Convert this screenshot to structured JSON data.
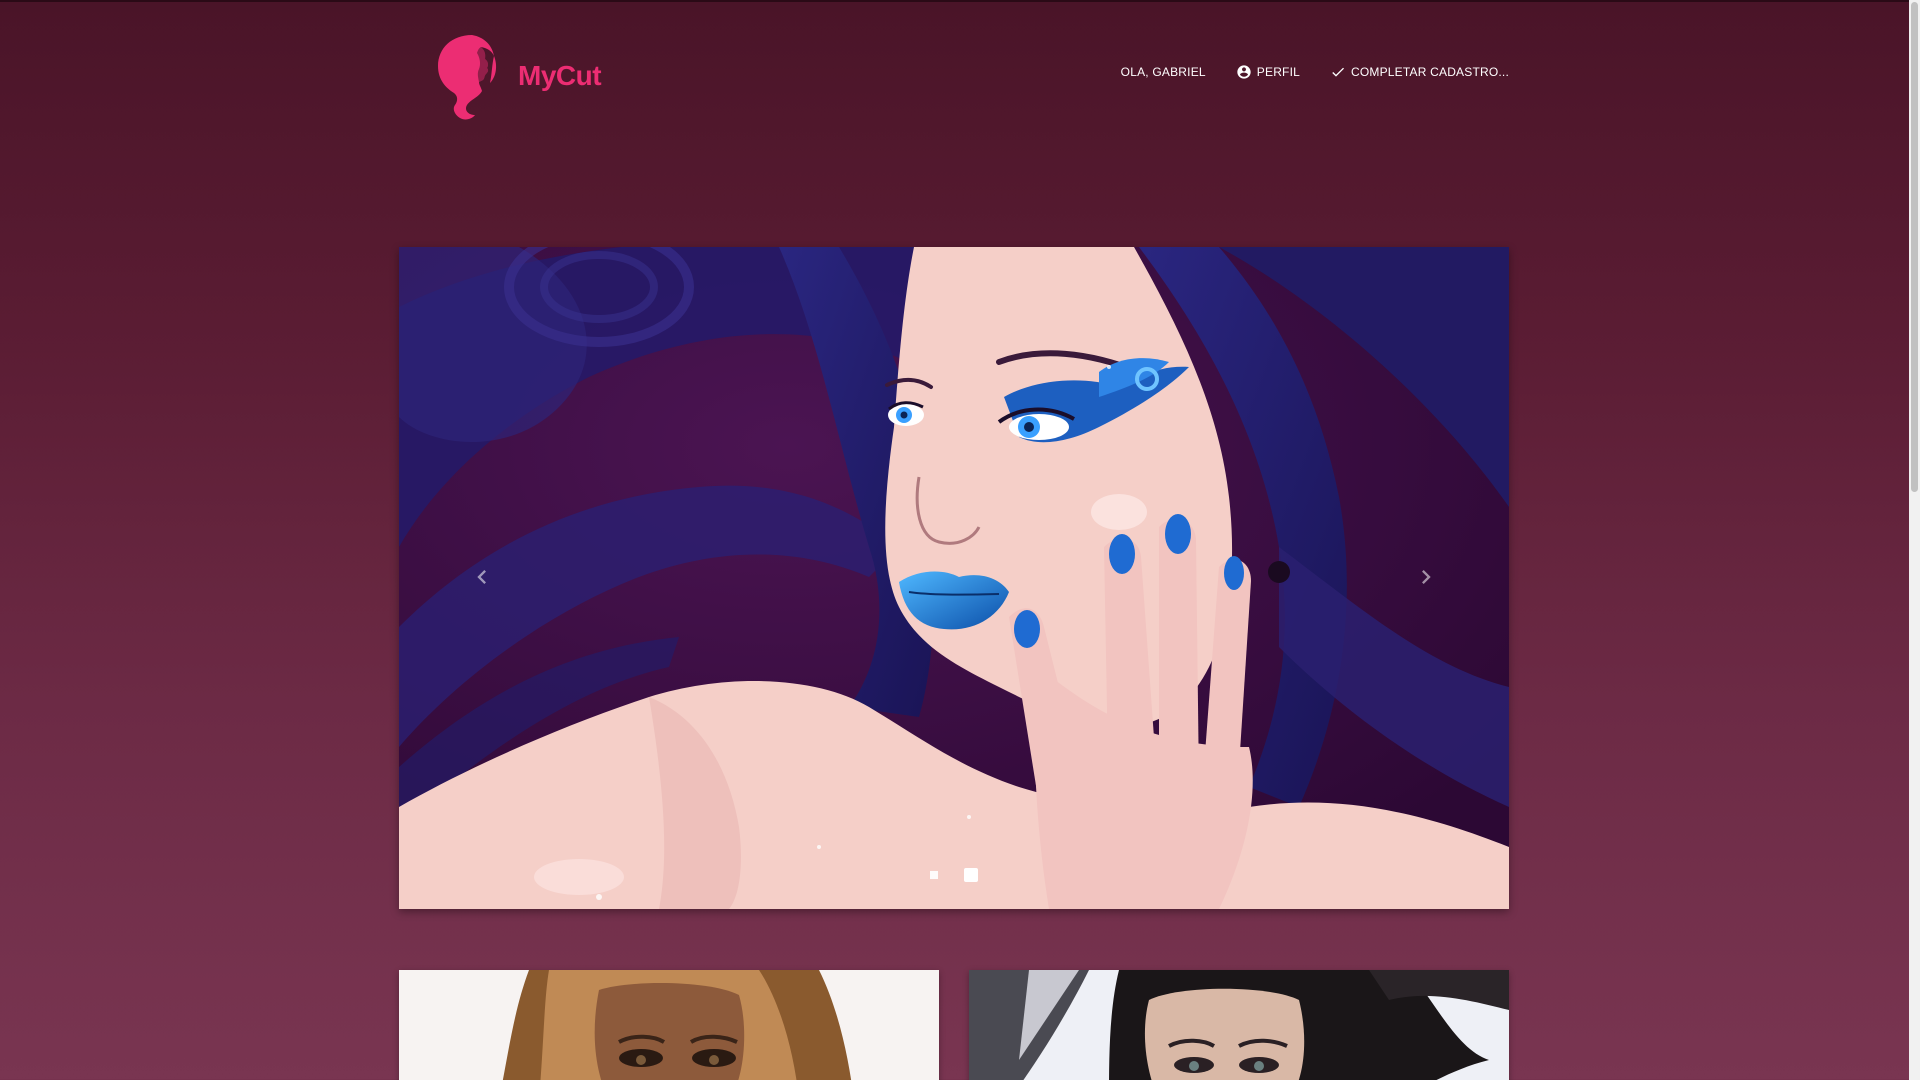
{
  "app": {
    "brand": "MyCut",
    "brand_color": "#ec2d73"
  },
  "nav": {
    "greeting": "OLA, GABRIEL",
    "profile_label": "PERFIL",
    "profile_icon": "account-circle-icon",
    "complete_label": "COMPLETAR CADASTRO...",
    "complete_icon": "check-icon"
  },
  "carousel": {
    "slide_count": 2,
    "active_index": 1,
    "prev_icon": "chevron-left-icon",
    "next_icon": "chevron-right-icon"
  },
  "cards": [
    {
      "image": "portrait-photo"
    },
    {
      "image": "portrait-photo"
    }
  ]
}
